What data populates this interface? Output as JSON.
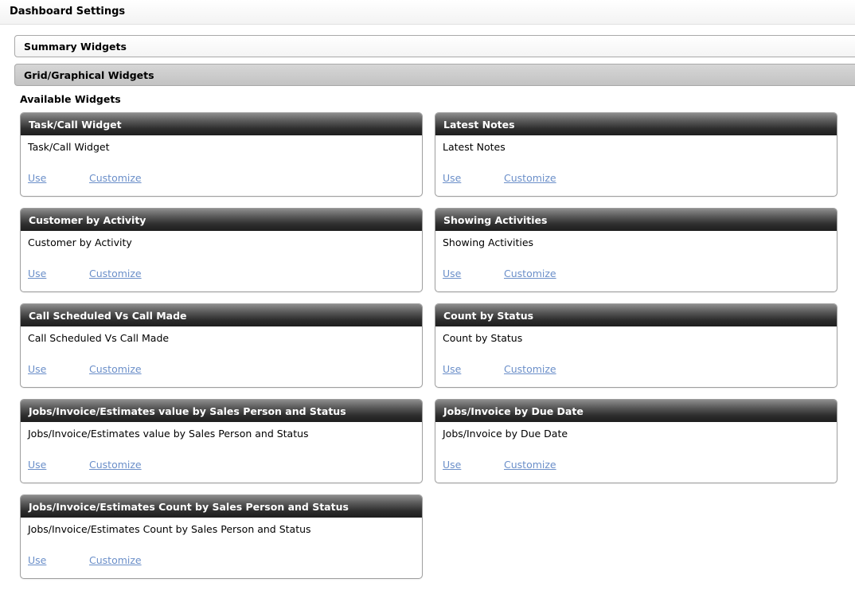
{
  "header": {
    "title": "Dashboard Settings"
  },
  "accordion": {
    "summary_label": "Summary Widgets",
    "grid_label": "Grid/Graphical Widgets"
  },
  "section": {
    "label": "Available Widgets"
  },
  "widgets": [
    {
      "title": "Task/Call Widget",
      "description": "Task/Call Widget",
      "use_label": "Use",
      "customize_label": "Customize"
    },
    {
      "title": "Latest Notes",
      "description": "Latest Notes",
      "use_label": "Use",
      "customize_label": "Customize"
    },
    {
      "title": "Customer by Activity",
      "description": "Customer by Activity",
      "use_label": "Use",
      "customize_label": "Customize"
    },
    {
      "title": "Showing Activities",
      "description": "Showing Activities",
      "use_label": "Use",
      "customize_label": "Customize"
    },
    {
      "title": "Call Scheduled Vs Call Made",
      "description": "Call Scheduled Vs Call Made",
      "use_label": "Use",
      "customize_label": "Customize"
    },
    {
      "title": "Count by Status",
      "description": "Count by Status",
      "use_label": "Use",
      "customize_label": "Customize"
    },
    {
      "title": "Jobs/Invoice/Estimates value by Sales Person and Status",
      "description": "Jobs/Invoice/Estimates value by Sales Person and Status",
      "use_label": "Use",
      "customize_label": "Customize"
    },
    {
      "title": "Jobs/Invoice by Due Date",
      "description": "Jobs/Invoice by Due Date",
      "use_label": "Use",
      "customize_label": "Customize"
    },
    {
      "title": "Jobs/Invoice/Estimates Count by Sales Person and Status",
      "description": "Jobs/Invoice/Estimates Count by Sales Person and Status",
      "use_label": "Use",
      "customize_label": "Customize"
    }
  ]
}
